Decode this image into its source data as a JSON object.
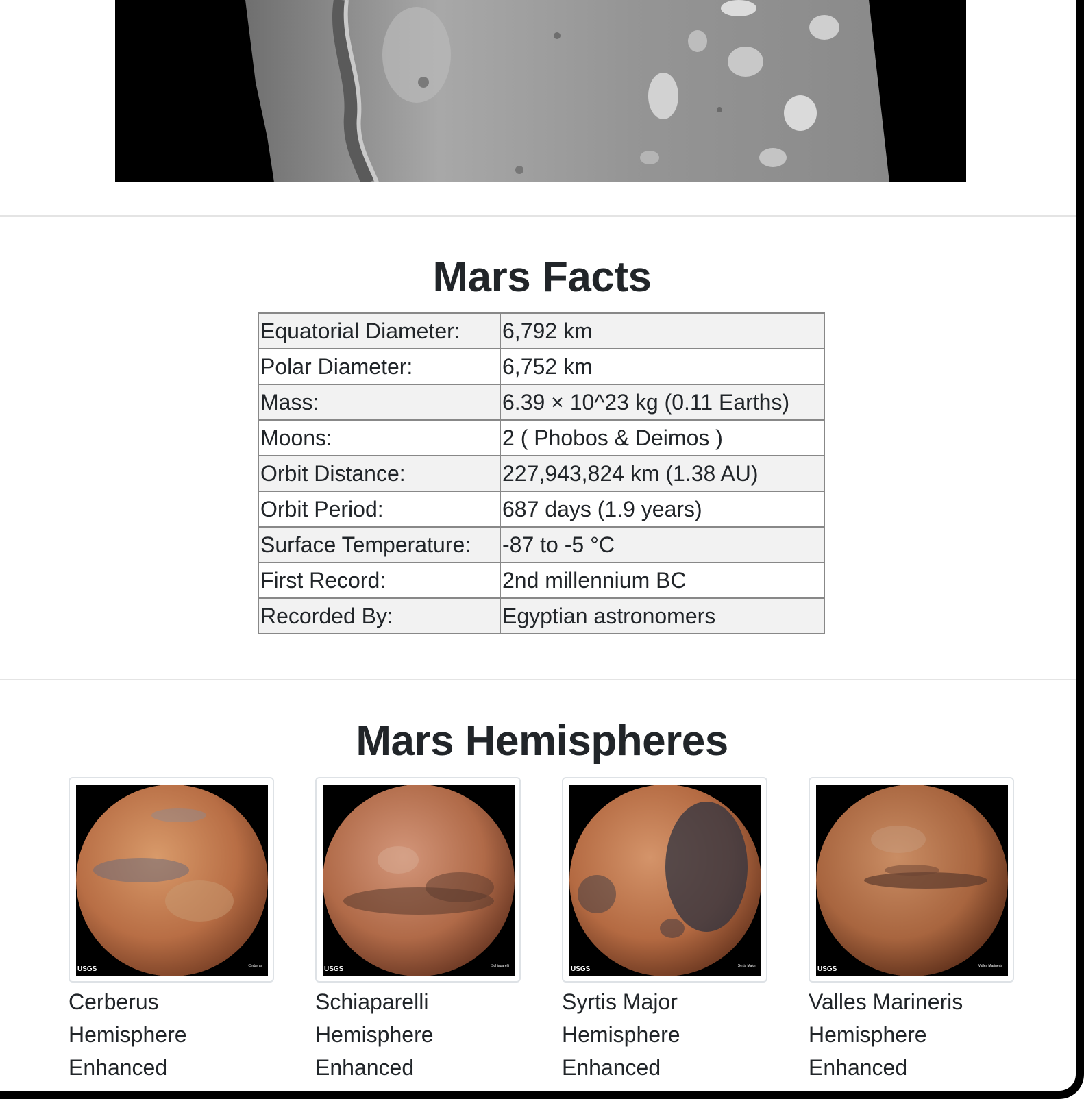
{
  "featured_image": {
    "alt": "Mars surface featured image"
  },
  "facts": {
    "title": "Mars Facts",
    "rows": [
      {
        "label": "Equatorial Diameter:",
        "value": "6,792 km"
      },
      {
        "label": "Polar Diameter:",
        "value": "6,752 km"
      },
      {
        "label": "Mass:",
        "value": "6.39 × 10^23 kg (0.11 Earths)"
      },
      {
        "label": "Moons:",
        "value": "2 ( Phobos & Deimos )"
      },
      {
        "label": "Orbit Distance:",
        "value": "227,943,824 km (1.38 AU)"
      },
      {
        "label": "Orbit Period:",
        "value": "687 days (1.9 years)"
      },
      {
        "label": "Surface Temperature:",
        "value": "-87 to -5 °C"
      },
      {
        "label": "First Record:",
        "value": "2nd millennium BC"
      },
      {
        "label": "Recorded By:",
        "value": "Egyptian astronomers"
      }
    ]
  },
  "hemispheres": {
    "title": "Mars Hemispheres",
    "items": [
      {
        "line1": "Cerberus",
        "line2": "Hemisphere",
        "line3": "Enhanced",
        "credit": "USGS",
        "img_label": "Cerberus"
      },
      {
        "line1": "Schiaparelli",
        "line2": "Hemisphere",
        "line3": "Enhanced",
        "credit": "USGS",
        "img_label": "Schiaparelli"
      },
      {
        "line1": "Syrtis Major",
        "line2": "Hemisphere",
        "line3": "Enhanced",
        "credit": "USGS",
        "img_label": "Syrtis Major"
      },
      {
        "line1": "Valles Marineris",
        "line2": "Hemisphere",
        "line3": "Enhanced",
        "credit": "USGS",
        "img_label": "Valles Marineris"
      }
    ]
  },
  "colors": {
    "text": "#212529",
    "table_border": "#888888",
    "row_stripe": "#f2f2f2",
    "divider": "#e4e4e4"
  }
}
